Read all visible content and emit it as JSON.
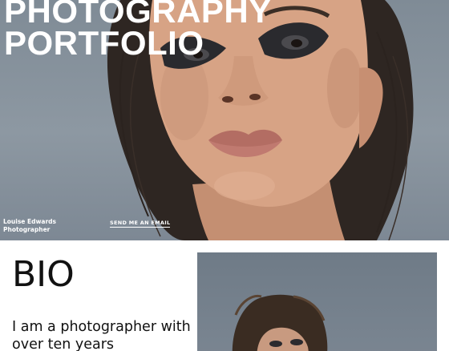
{
  "hero": {
    "title_line1": "PHOTOGRAPHY",
    "title_line2": "PORTFOLIO",
    "name": "Louise Edwards",
    "role": "Photographer",
    "email_link": "SEND ME AN EMAIL"
  },
  "bio": {
    "heading": "BIO",
    "text": "I am a photographer with over ten years"
  },
  "colors": {
    "hero_background": "#8a95a0",
    "text_dark": "#111111",
    "text_light": "#ffffff"
  }
}
